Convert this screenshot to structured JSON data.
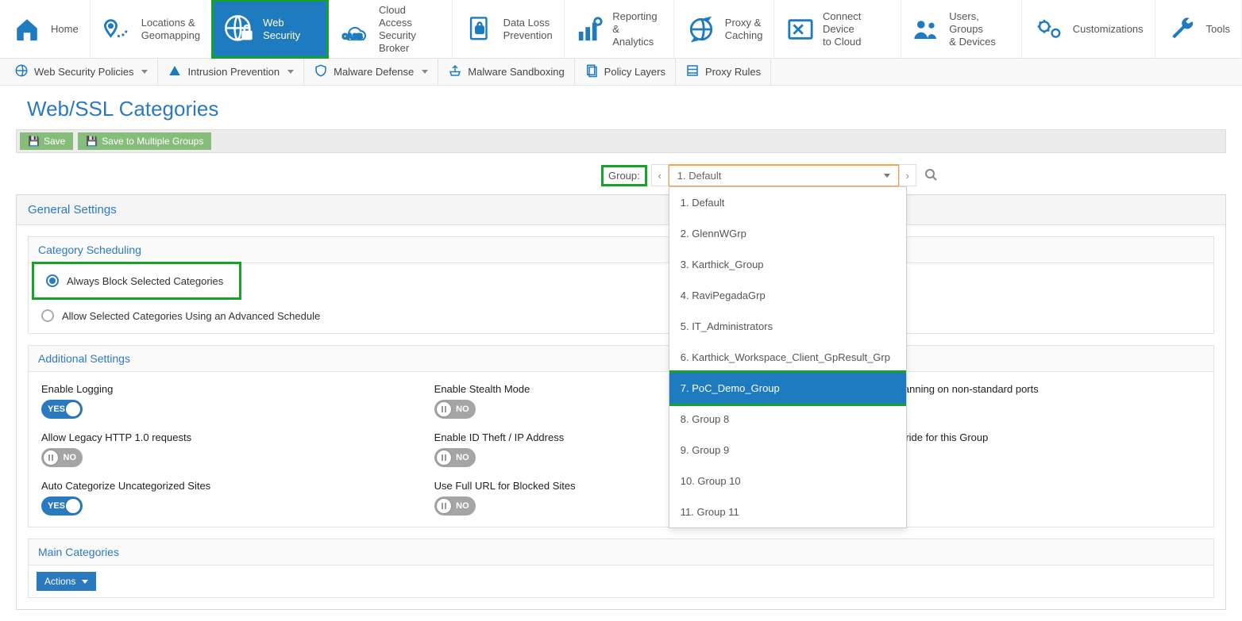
{
  "topnav": [
    {
      "id": "home",
      "label": "Home"
    },
    {
      "id": "locations",
      "label": "Locations &\nGeomapping"
    },
    {
      "id": "websec",
      "label": "Web Security",
      "active": true,
      "highlight": true
    },
    {
      "id": "casb",
      "label": "Cloud Access\nSecurity Broker"
    },
    {
      "id": "dlp",
      "label": "Data Loss\nPrevention"
    },
    {
      "id": "reporting",
      "label": "Reporting &\nAnalytics"
    },
    {
      "id": "proxy",
      "label": "Proxy &\nCaching"
    },
    {
      "id": "connect",
      "label": "Connect Device\nto Cloud"
    },
    {
      "id": "users",
      "label": "Users, Groups\n& Devices"
    },
    {
      "id": "custom",
      "label": "Customizations"
    },
    {
      "id": "tools",
      "label": "Tools"
    }
  ],
  "subnav": [
    {
      "id": "wsp",
      "label": "Web Security Policies",
      "dropdown": true
    },
    {
      "id": "ips",
      "label": "Intrusion Prevention",
      "dropdown": true
    },
    {
      "id": "malware",
      "label": "Malware Defense",
      "dropdown": true
    },
    {
      "id": "sandbox",
      "label": "Malware Sandboxing",
      "dropdown": false
    },
    {
      "id": "layers",
      "label": "Policy Layers",
      "dropdown": false
    },
    {
      "id": "proxyrules",
      "label": "Proxy Rules",
      "dropdown": false
    }
  ],
  "page": {
    "title": "Web/SSL Categories"
  },
  "actions": {
    "save": "Save",
    "saveMulti": "Save to Multiple Groups"
  },
  "group": {
    "label": "Group:",
    "selected": "1. Default",
    "options": [
      "1. Default",
      "2. GlennWGrp",
      "3. Karthick_Group",
      "4. RaviPegadaGrp",
      "5. IT_Administrators",
      "6. Karthick_Workspace_Client_GpResult_Grp",
      "7. PoC_Demo_Group",
      "8. Group 8",
      "9. Group 9",
      "10. Group 10",
      "11. Group 11"
    ],
    "highlightIndex": 6
  },
  "general": {
    "title": "General Settings",
    "scheduling": {
      "title": "Category Scheduling",
      "opt_always": "Always Block Selected Categories",
      "opt_allow": "Allow Selected Categories Using an Advanced Schedule",
      "selected": "always"
    }
  },
  "additional": {
    "title": "Additional Settings",
    "rows": [
      [
        {
          "label": "Enable Logging",
          "on": true
        },
        {
          "label": "Enable Stealth Mode",
          "on": false
        },
        {
          "label": "Enable HTTP Scanning on non-standard ports",
          "on": false
        }
      ],
      [
        {
          "label": "Allow Legacy HTTP 1.0 requests",
          "on": false
        },
        {
          "label": "Enable ID Theft / IP Address",
          "on": false
        },
        {
          "label": "Enable Soft Override for this Group",
          "on": false
        }
      ],
      [
        {
          "label": "Auto Categorize Uncategorized Sites",
          "on": true
        },
        {
          "label": "Use Full URL for Blocked Sites",
          "on": false
        },
        null
      ]
    ]
  },
  "mainCat": {
    "title": "Main Categories",
    "actions": "Actions"
  },
  "toggleText": {
    "yes": "YES",
    "no": "NO"
  }
}
